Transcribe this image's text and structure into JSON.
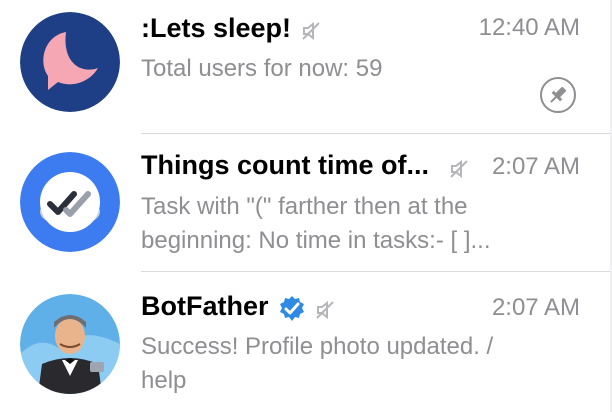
{
  "chats": [
    {
      "name": ":Lets sleep!",
      "time": "12:40 AM",
      "preview_lines": [
        "Total users for now: 59"
      ],
      "muted": true,
      "pinned": true,
      "avatar_icon": "moon-icon",
      "avatar_colors": {
        "bg": "#1e3f86",
        "moon": "#f5a7b4"
      }
    },
    {
      "name": "Things count time of...",
      "time": "2:07 AM",
      "preview_lines": [
        "Task with \"(\" farther then at the",
        "beginning:   No time in tasks:- [ ]..."
      ],
      "muted": true,
      "pinned": false,
      "avatar_icon": "double-check-icon",
      "avatar_colors": {
        "bg": "#3d7cf0",
        "badge": "#ffffff"
      }
    },
    {
      "name": "BotFather",
      "time": "2:07 AM",
      "preview_lines": [
        "Success! Profile photo updated. /",
        "help"
      ],
      "muted": true,
      "verified": true,
      "pinned": false,
      "avatar_icon": "botfather-avatar",
      "avatar_colors": {
        "bg": "#5fb0e8"
      }
    }
  ],
  "colors": {
    "verified": "#2f8ae5",
    "muted_icon": "#b5b5ba"
  }
}
